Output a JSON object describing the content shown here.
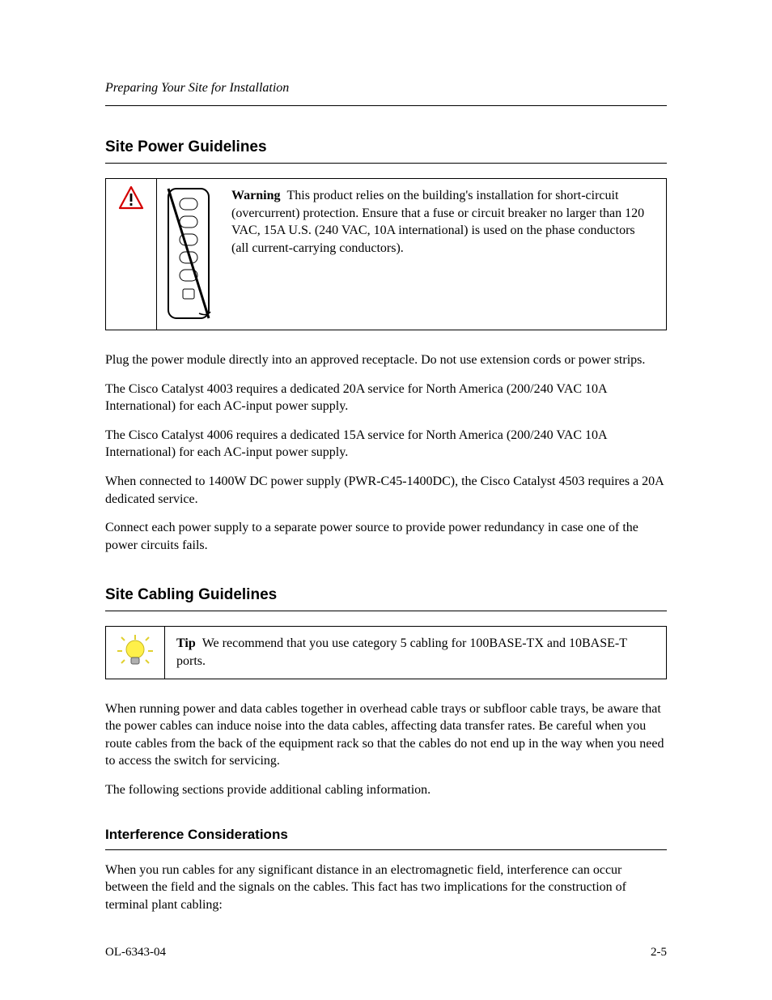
{
  "running_head": "Preparing Your Site for Installation",
  "section_power": {
    "title": "Site Power Guidelines",
    "warning": "This product relies on the building's installation for short-circuit (overcurrent) protection. Ensure that a fuse or circuit breaker no larger than 120 VAC, 15A U.S. (240 VAC, 10A international) is used on the phase conductors (all current-carrying conductors).",
    "paragraphs": [
      "Plug the power module directly into an approved receptacle. Do not use extension cords or power strips.",
      "The Cisco Catalyst 4003 requires a dedicated 20A service for North America (200/240 VAC 10A International) for each AC-input power supply.",
      "The Cisco Catalyst 4006 requires a dedicated 15A service for North America (200/240 VAC 10A International) for each AC-input power supply.",
      "When connected to 1400W DC power supply (PWR-C45-1400DC), the Cisco Catalyst 4503 requires a 20A dedicated service.",
      "Connect each power supply to a separate power source to provide power redundancy in case one of the power circuits fails."
    ]
  },
  "section_cabling": {
    "title": "Site Cabling Guidelines",
    "tip": "We recommend that you use category 5 cabling for 100BASE-TX and 10BASE-T ports.",
    "paragraphs": [
      "When running power and data cables together in overhead cable trays or subfloor cable trays, be aware that the power cables can induce noise into the data cables, affecting data transfer rates. Be careful when you route cables from the back of the equipment rack so that the cables do not end up in the way when you need to access the switch for servicing.",
      "The following sections provide additional cabling information."
    ]
  },
  "section_interference": {
    "title": "Interference Considerations",
    "paragraphs": [
      "When you run cables for any significant distance in an electromagnetic field, interference can occur between the field and the signals on the cables. This fact has two implications for the construction of terminal plant cabling:"
    ]
  },
  "footer": {
    "doc_id": "OL-6343-04",
    "page_num": "2-5"
  }
}
